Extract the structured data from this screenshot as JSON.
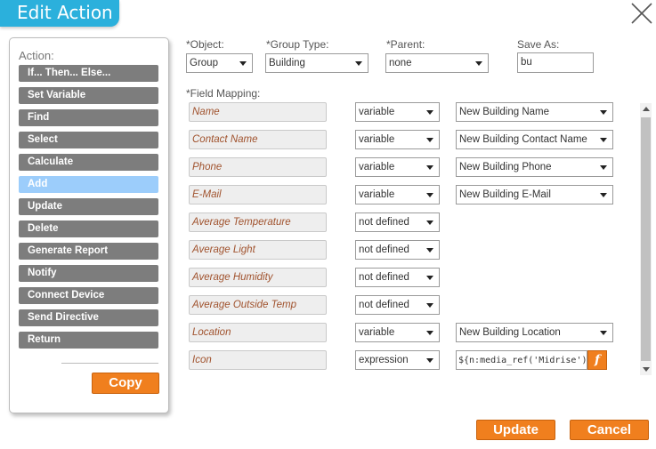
{
  "title": "Edit Action",
  "actions": {
    "label": "Action:",
    "items": [
      "If... Then... Else...",
      "Set Variable",
      "Find",
      "Select",
      "Calculate",
      "Add",
      "Update",
      "Delete",
      "Generate Report",
      "Notify",
      "Connect Device",
      "Send Directive",
      "Return"
    ],
    "selected": "Add",
    "copy_label": "Copy"
  },
  "header": {
    "object": {
      "label": "*Object:",
      "value": "Group"
    },
    "group_type": {
      "label": "*Group Type:",
      "value": "Building"
    },
    "parent": {
      "label": "*Parent:",
      "value": "none"
    },
    "save_as": {
      "label": "Save As:",
      "value": "bu"
    }
  },
  "field_mapping": {
    "label": "*Field Mapping:",
    "rows": [
      {
        "field": "Name",
        "mode": "variable",
        "value": "New Building Name"
      },
      {
        "field": "Contact Name",
        "mode": "variable",
        "value": "New Building Contact Name"
      },
      {
        "field": "Phone",
        "mode": "variable",
        "value": "New Building Phone"
      },
      {
        "field": "E-Mail",
        "mode": "variable",
        "value": "New Building E-Mail"
      },
      {
        "field": "Average Temperature",
        "mode": "not defined",
        "value": ""
      },
      {
        "field": "Average Light",
        "mode": "not defined",
        "value": ""
      },
      {
        "field": "Average Humidity",
        "mode": "not defined",
        "value": ""
      },
      {
        "field": "Average Outside Temp",
        "mode": "not defined",
        "value": ""
      },
      {
        "field": "Location",
        "mode": "variable",
        "value": "New Building Location"
      },
      {
        "field": "Icon",
        "mode": "expression",
        "value": "${n:media_ref('Midrise')}"
      }
    ],
    "fn_label": "f"
  },
  "footer": {
    "update_label": "Update",
    "cancel_label": "Cancel"
  },
  "colors": {
    "accent": "#f07f1e",
    "title_bg": "#2bb0dc",
    "action_btn": "#7d7d7d",
    "action_selected": "#9ccdfb",
    "field_text": "#a0522d"
  },
  "icons": {
    "close": "close-icon",
    "dropdown": "chevron-down-icon",
    "function": "function-icon"
  }
}
